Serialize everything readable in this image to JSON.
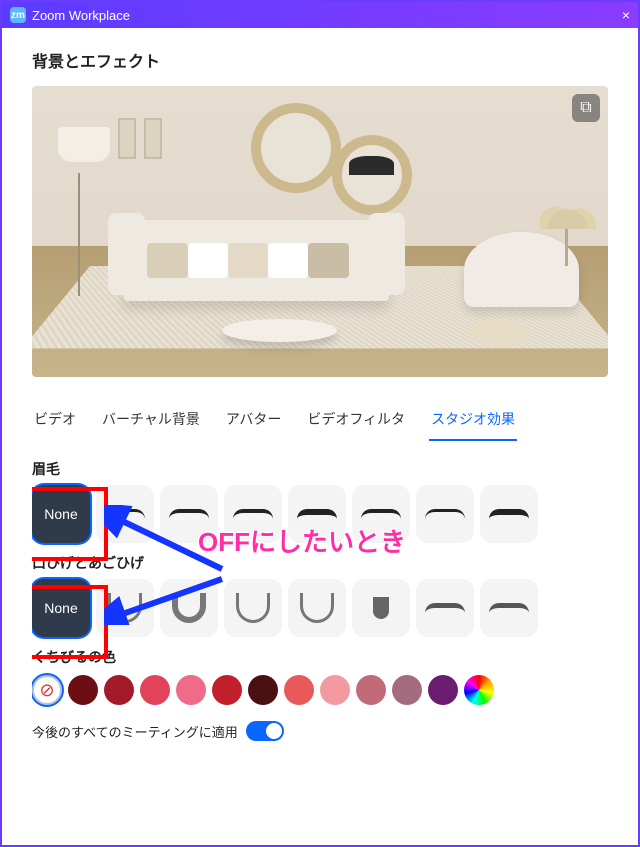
{
  "window": {
    "title": "Zoom Workplace",
    "close_icon": "×"
  },
  "page_title": "背景とエフェクト",
  "preview": {
    "pip_icon": "⧉"
  },
  "tabs": {
    "video": "ビデオ",
    "virtual_bg": "バーチャル背景",
    "avatar": "アバター",
    "video_filter": "ビデオフィルタ",
    "studio_fx": "スタジオ効果",
    "active": "studio_fx"
  },
  "sections": {
    "eyebrows": {
      "label": "眉毛",
      "none_label": "None"
    },
    "beard": {
      "label": "口ひげとあごひげ",
      "none_label": "None"
    },
    "lips": {
      "label": "くちびるの色"
    }
  },
  "lip_colors": [
    "none",
    "#6b0f14",
    "#a31b2b",
    "#e2435a",
    "#f06a8a",
    "#c21e2c",
    "#4a1012",
    "#e85a5a",
    "#f39aa0",
    "#c26a78",
    "#a56b7f",
    "#6a1d6e",
    "rainbow"
  ],
  "apply_all": {
    "label": "今後のすべてのミーティングに適用",
    "on": true
  },
  "annotation": {
    "text": "OFFにしたいとき"
  }
}
